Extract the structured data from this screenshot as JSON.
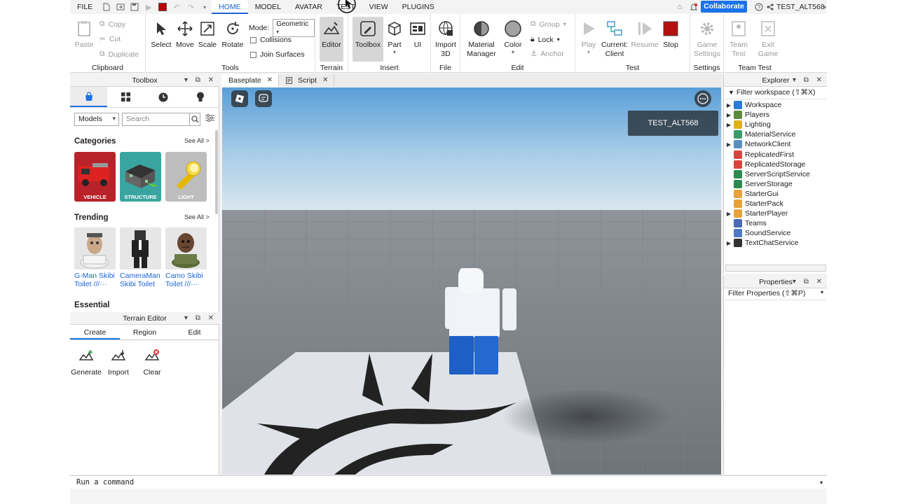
{
  "menubar": {
    "items": [
      "FILE",
      "HOME",
      "MODEL",
      "AVATAR",
      "TEST",
      "VIEW",
      "PLUGINS"
    ],
    "collaborate_label": "Collaborate",
    "user": "TEST_ALT568"
  },
  "ribbon": {
    "clipboard": {
      "paste": "Paste",
      "copy": "Copy",
      "cut": "Cut",
      "duplicate": "Duplicate",
      "label": "Clipboard"
    },
    "tools": {
      "select": "Select",
      "move": "Move",
      "scale": "Scale",
      "rotate": "Rotate",
      "mode_label": "Mode:",
      "mode_value": "Geometric",
      "collisions": "Collisions",
      "join_surfaces": "Join Surfaces",
      "label": "Tools"
    },
    "terrain": {
      "editor": "Editor",
      "label": "Terrain"
    },
    "insert": {
      "toolbox": "Toolbox",
      "part": "Part",
      "ui": "UI",
      "label": "Insert"
    },
    "file": {
      "import3d_line1": "Import",
      "import3d_line2": "3D",
      "label": "File"
    },
    "edit": {
      "material_line1": "Material",
      "material_line2": "Manager",
      "color": "Color",
      "group": "Group",
      "lock": "Lock",
      "anchor": "Anchor",
      "label": "Edit"
    },
    "test": {
      "play": "Play",
      "client_line1": "Current:",
      "client_line2": "Client",
      "resume": "Resume",
      "stop": "Stop",
      "label": "Test"
    },
    "settings": {
      "game_line1": "Game",
      "game_line2": "Settings",
      "label": "Settings"
    },
    "team_test": {
      "team_line1": "Team",
      "team_line2": "Test",
      "exit_line1": "Exit",
      "exit_line2": "Game",
      "label": "Team Test"
    }
  },
  "toolbox": {
    "title": "Toolbox",
    "category_select": "Models",
    "search_placeholder": "Search",
    "categories_heading": "Categories",
    "see_all": "See All >",
    "categories": [
      {
        "label": "VEHICLE",
        "color": "#b8232a"
      },
      {
        "label": "STRUCTURE",
        "color": "#3aa5a0"
      },
      {
        "label": "LIGHT",
        "color": "#bdbdbd"
      }
    ],
    "trending_heading": "Trending",
    "trending": [
      {
        "line1": "G-Man Skibi",
        "line2": "Toilet ///···"
      },
      {
        "line1": "CameraMan",
        "line2": "Skibi Toilet"
      },
      {
        "line1": "Camo Skibi",
        "line2": "Toilet ///···"
      }
    ],
    "essential_heading": "Essential"
  },
  "terrain_editor": {
    "title": "Terrain Editor",
    "tabs": [
      "Create",
      "Region",
      "Edit"
    ],
    "tools": [
      "Generate",
      "Import",
      "Clear"
    ]
  },
  "doc_tabs": [
    "Baseplate",
    "Script"
  ],
  "viewport": {
    "player_name": "TEST_ALT568"
  },
  "explorer": {
    "title": "Explorer",
    "filter": "Filter workspace (⇧⌘X)",
    "items": [
      {
        "label": "Workspace",
        "expandable": true,
        "color": "#2a7bd4"
      },
      {
        "label": "Players",
        "expandable": true,
        "color": "#5b8a3a"
      },
      {
        "label": "Lighting",
        "expandable": true,
        "color": "#e0b020"
      },
      {
        "label": "MaterialService",
        "expandable": false,
        "color": "#3a9a6a"
      },
      {
        "label": "NetworkClient",
        "expandable": true,
        "color": "#5a8fc0"
      },
      {
        "label": "ReplicatedFirst",
        "expandable": false,
        "color": "#d6453d"
      },
      {
        "label": "ReplicatedStorage",
        "expandable": false,
        "color": "#d6453d"
      },
      {
        "label": "ServerScriptService",
        "expandable": false,
        "color": "#2d8a4e"
      },
      {
        "label": "ServerStorage",
        "expandable": false,
        "color": "#2d8a4e"
      },
      {
        "label": "StarterGui",
        "expandable": false,
        "color": "#e8a23a"
      },
      {
        "label": "StarterPack",
        "expandable": false,
        "color": "#e8a23a"
      },
      {
        "label": "StarterPlayer",
        "expandable": true,
        "color": "#e8a23a"
      },
      {
        "label": "Teams",
        "expandable": false,
        "color": "#4a6ab4"
      },
      {
        "label": "SoundService",
        "expandable": false,
        "color": "#4a7ac4"
      },
      {
        "label": "TextChatService",
        "expandable": true,
        "color": "#333333"
      }
    ]
  },
  "properties": {
    "title": "Properties",
    "filter": "Filter Properties (⇧⌘P)"
  },
  "command_bar": {
    "placeholder": "Run a command"
  }
}
